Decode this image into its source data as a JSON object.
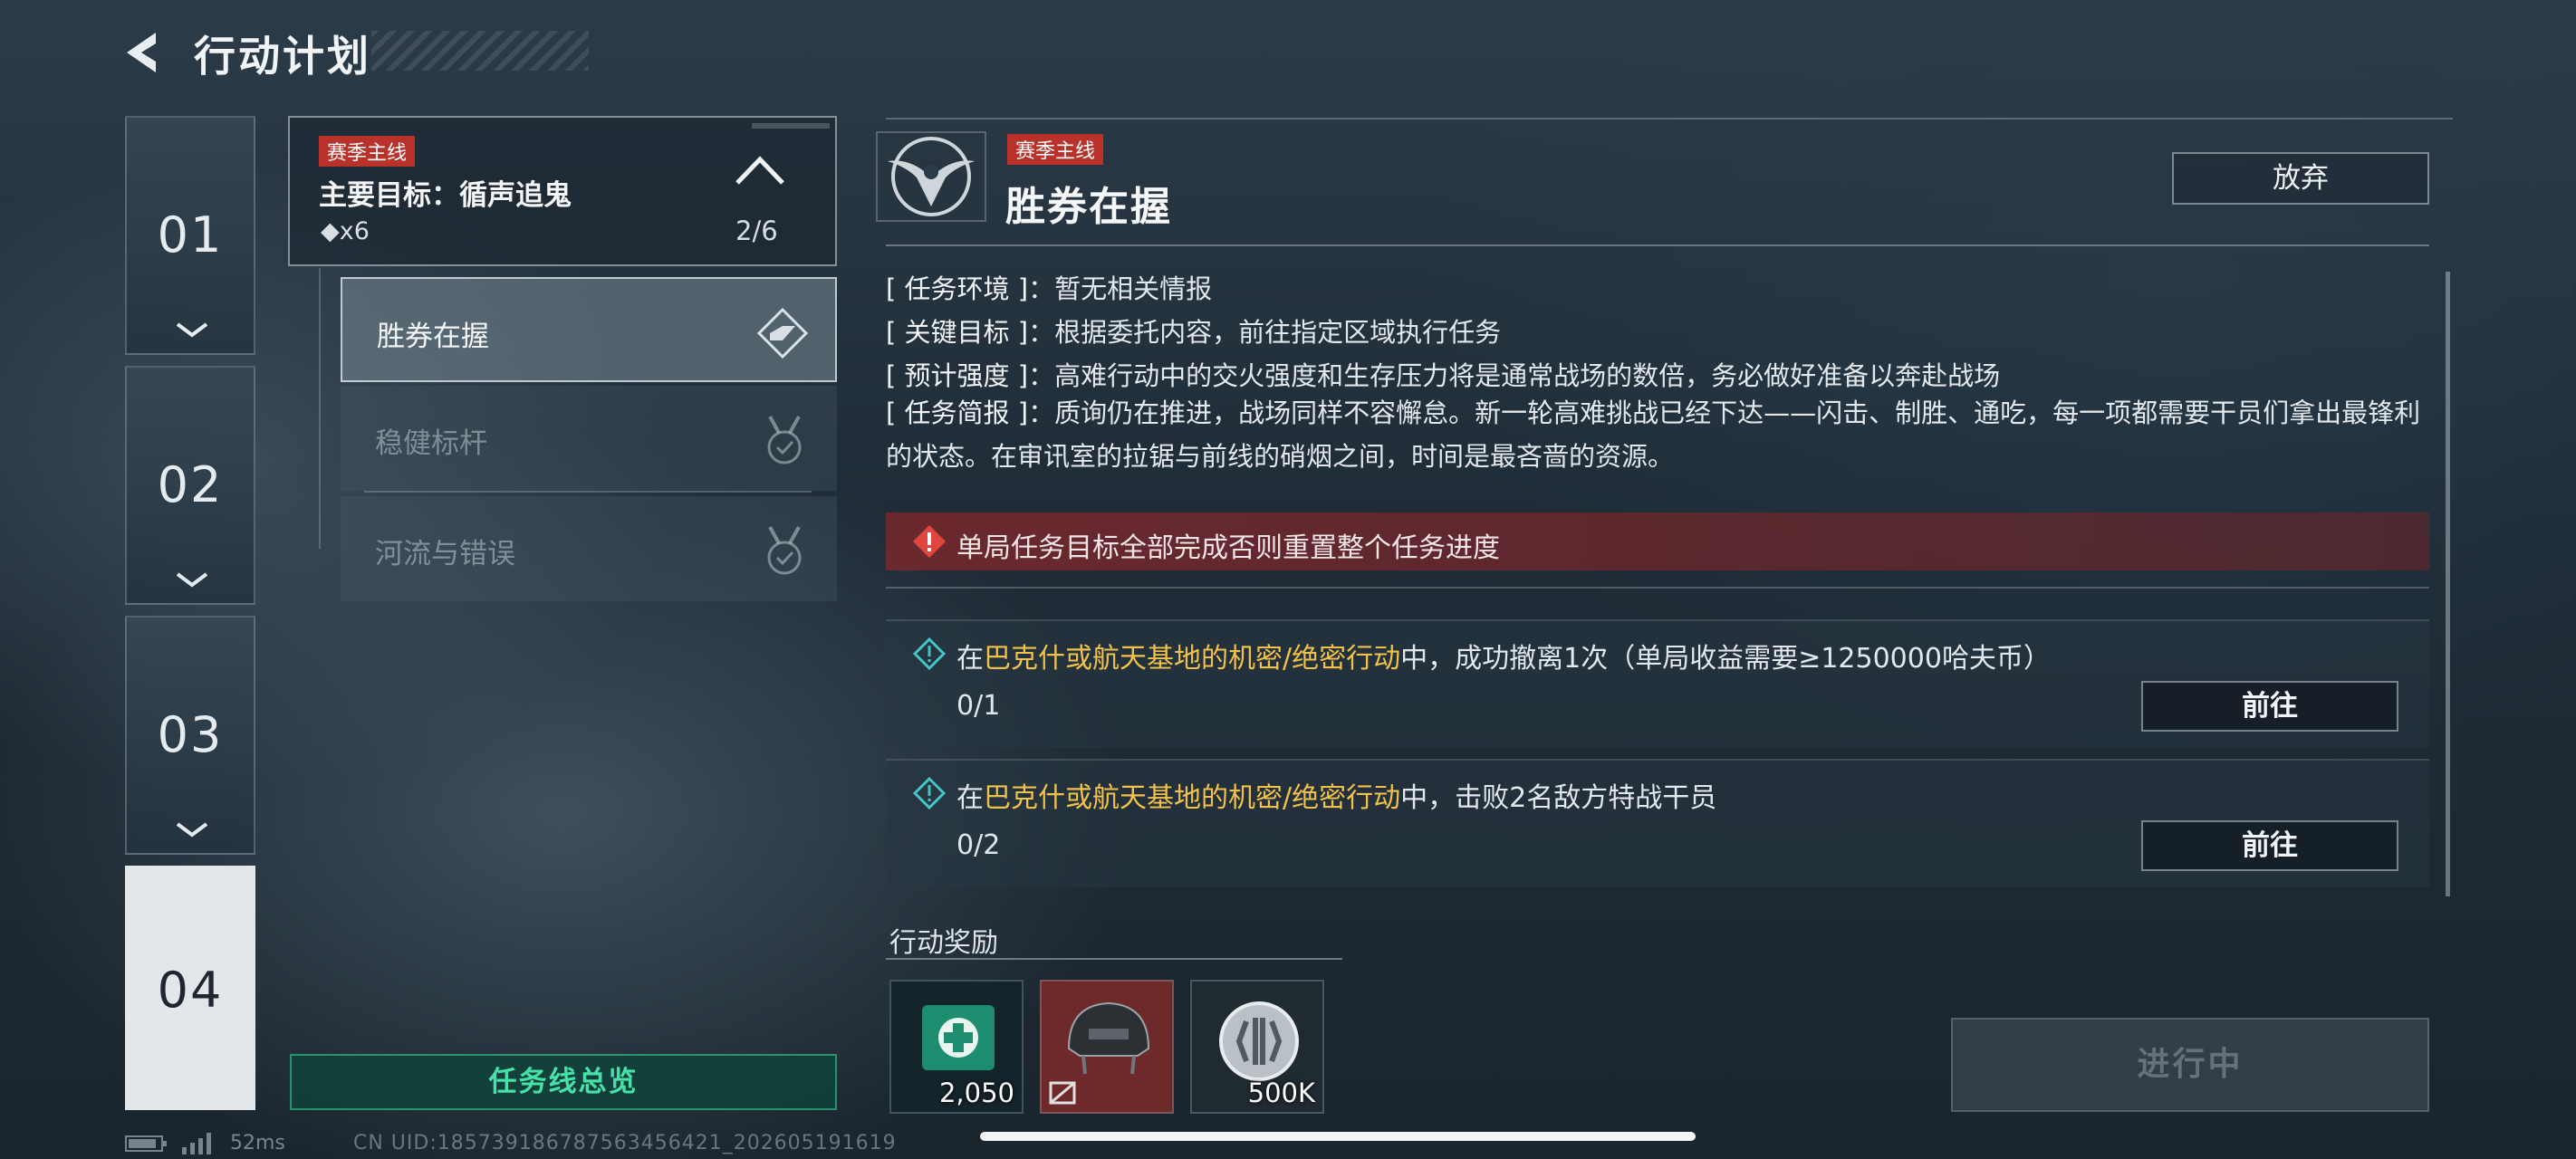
{
  "header": {
    "title": "行动计划",
    "back_icon": "back-arrow-icon"
  },
  "stages": [
    {
      "num": "01",
      "active": false
    },
    {
      "num": "02",
      "active": false
    },
    {
      "num": "03",
      "active": false
    },
    {
      "num": "04",
      "active": true
    }
  ],
  "mission": {
    "tag": "赛季主线",
    "title": "主要目标：循声追鬼",
    "diamond_count": "◆x6",
    "progress": "2/6",
    "sub_tasks": [
      {
        "label": "胜券在握",
        "state": "active",
        "icon": "target-diamond-icon"
      },
      {
        "label": "稳健标杆",
        "state": "completed",
        "icon": "medal-check-icon"
      },
      {
        "label": "河流与错误",
        "state": "completed",
        "icon": "medal-check-icon"
      }
    ],
    "overview_button": "任务线总览"
  },
  "detail": {
    "tag": "赛季主线",
    "title": "胜券在握",
    "abandon_button": "放弃",
    "env_key": "[ 任务环境 ]",
    "env_val": "：暂无相关情报",
    "goal_key": "[ 关键目标 ]",
    "goal_val": "：根据委托内容，前往指定区域执行任务",
    "intensity_key": "[ 预计强度 ]",
    "intensity_val": "：高难行动中的交火强度和生存压力将是通常战场的数倍，务必做好准备以奔赴战场",
    "brief_key": "[ 任务简报 ]",
    "brief_val": "：质询仍在推进，战场同样不容懈怠。新一轮高难挑战已经下达——闪击、制胜、通吃，每一项都需要干员们拿出最锋利的状态。在审讯室的拉锯与前线的硝烟之间，时间是最吝啬的资源。",
    "warning": "单局任务目标全部完成否则重置整个任务进度",
    "objectives": [
      {
        "prefix": "在",
        "highlight": "巴克什或航天基地的机密/绝密行动",
        "suffix": "中，成功撤离1次（单局收益需要≥1250000哈夫币）",
        "progress": "0/1",
        "button": "前往"
      },
      {
        "prefix": "在",
        "highlight": "巴克什或航天基地的机密/绝密行动",
        "suffix": "中，击败2名敌方特战干员",
        "progress": "0/2",
        "button": "前往"
      }
    ],
    "reward_label": "行动奖励",
    "rewards": [
      {
        "icon": "medkit-voucher-icon",
        "amount": "2,050",
        "color": "#1e8c6f"
      },
      {
        "icon": "helmet-icon",
        "amount": "",
        "color": "#7a2e2e"
      },
      {
        "icon": "coin-icon",
        "amount": "500K",
        "color": "#2a343c"
      }
    ],
    "status_button": "进行中"
  },
  "footer": {
    "ping": "52ms",
    "uid": "CN UID:185739186787563456421_202605191619"
  },
  "colors": {
    "accent_green": "#47e0a8",
    "tag_red": "#b8312b",
    "highlight_yellow": "#f0c24a"
  }
}
